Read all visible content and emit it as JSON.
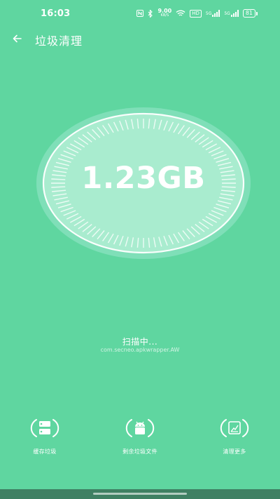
{
  "status_bar": {
    "time": "16:03",
    "net_speed_value": "9.00",
    "net_speed_unit": "KB/S",
    "hd_badge": "HD",
    "signal_1": "5G",
    "signal_2": "5G",
    "battery": "81"
  },
  "header": {
    "title": "垃圾清理"
  },
  "dial": {
    "size_value": "1.23GB"
  },
  "scan": {
    "status": "扫描中...",
    "current_item": "com.secneo.apkwrapper.AW"
  },
  "features": [
    {
      "label": "缓存垃圾",
      "icon": "cache-icon"
    },
    {
      "label": "剩余垃圾文件",
      "icon": "android-icon"
    },
    {
      "label": "清理更多",
      "icon": "clean-more-icon"
    }
  ],
  "colors": {
    "background": "#5fd6a0",
    "dial_outer": "#7fdfb8",
    "dial_inner": "#a9eccf",
    "nav_bar": "#3f8063"
  }
}
